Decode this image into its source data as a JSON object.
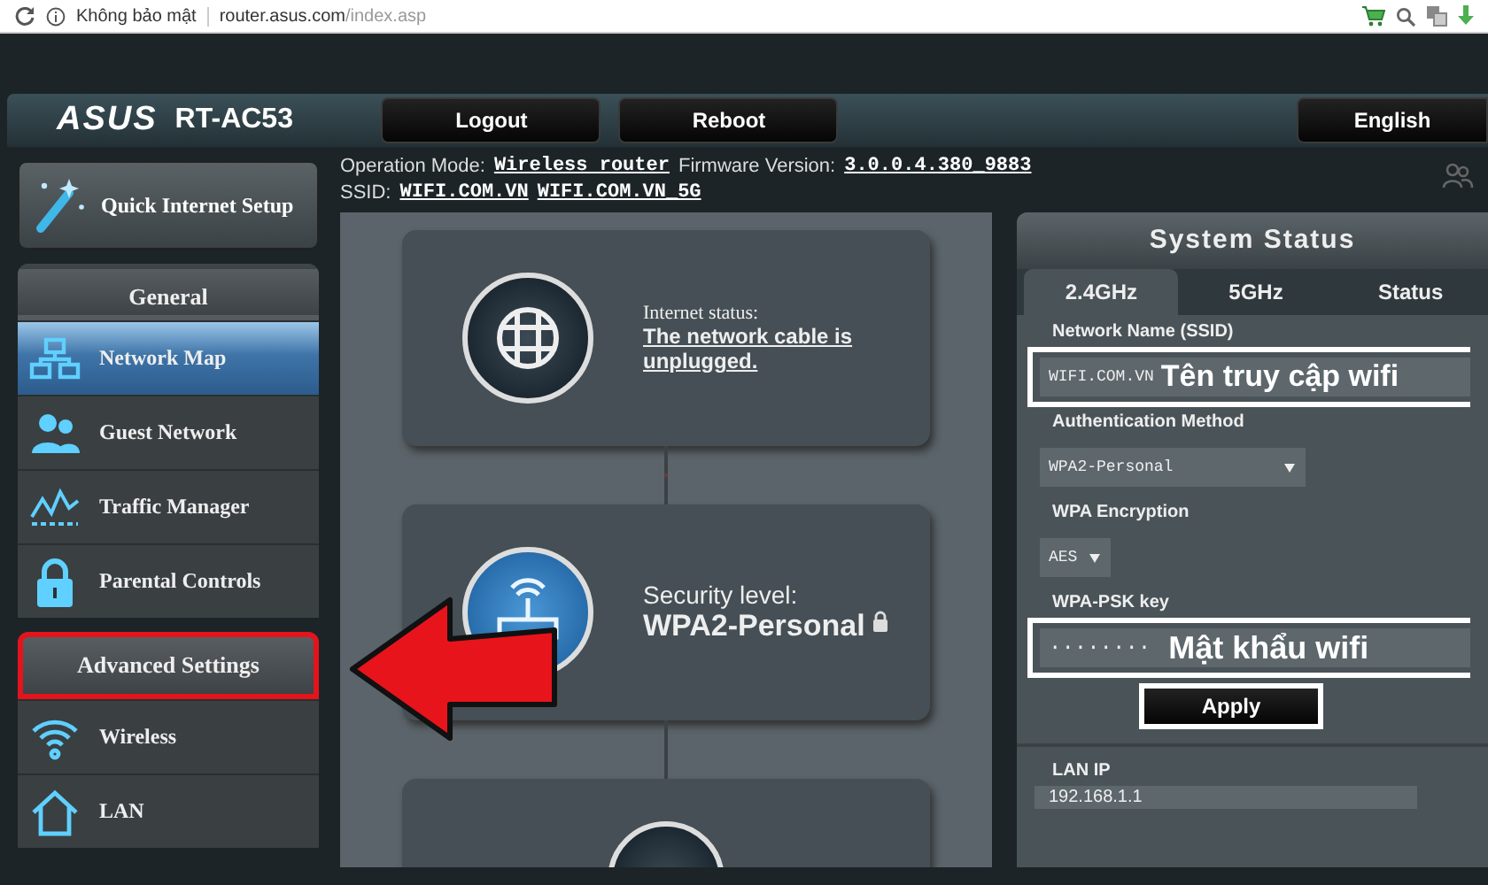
{
  "browser": {
    "security_label": "Không bảo mật",
    "url_host": "router.asus.com",
    "url_path": "/index.asp"
  },
  "header": {
    "logo": "ASUS",
    "model": "RT-AC53",
    "buttons": [
      "Logout",
      "Reboot"
    ],
    "language": "English"
  },
  "info": {
    "operation_mode_label": "Operation Mode:",
    "operation_mode": "Wireless router",
    "firmware_label": "Firmware Version:",
    "firmware": "3.0.0.4.380_9883",
    "ssid_label": "SSID:",
    "ssids": [
      "WIFI.COM.VN",
      "WIFI.COM.VN_5G"
    ]
  },
  "sidebar": {
    "quick_setup": "Quick Internet Setup",
    "sections": [
      {
        "title": "General",
        "highlighted": false,
        "items": [
          {
            "label": "Network Map",
            "kind": "network",
            "selected": true
          },
          {
            "label": "Guest Network",
            "kind": "users",
            "selected": false
          },
          {
            "label": "Traffic Manager",
            "kind": "traffic",
            "selected": false
          },
          {
            "label": "Parental Controls",
            "kind": "lock",
            "selected": false
          }
        ]
      },
      {
        "title": "Advanced Settings",
        "highlighted": true,
        "items": [
          {
            "label": "Wireless",
            "kind": "wifi",
            "selected": false
          },
          {
            "label": "LAN",
            "kind": "home",
            "selected": false
          }
        ]
      }
    ]
  },
  "map": {
    "nodes": [
      {
        "kind": "internet",
        "label": "Internet status:",
        "value": "The network cable is unplugged.",
        "link_broken": true
      },
      {
        "kind": "router",
        "label": "Security level:",
        "value": "WPA2-Personal",
        "locked": true,
        "link_broken": false
      },
      {
        "kind": "device"
      }
    ]
  },
  "status": {
    "title": "System Status",
    "tabs": [
      {
        "label": "2.4GHz",
        "selected": true
      },
      {
        "label": "5GHz",
        "selected": false
      },
      {
        "label": "Status",
        "selected": false
      }
    ],
    "fields": [
      {
        "kind": "text",
        "label": "Network Name (SSID)",
        "value": "WIFI.COM.VN",
        "note": "Tên truy cập wifi",
        "highlighted": true
      },
      {
        "kind": "select",
        "label": "Authentication Method",
        "value": "WPA2-Personal",
        "highlighted": false
      },
      {
        "kind": "select_small",
        "label": "WPA Encryption",
        "value": "AES",
        "highlighted": false
      },
      {
        "kind": "password",
        "label": "WPA-PSK key",
        "value": "········",
        "note": "Mật khẩu wifi",
        "highlighted": true
      }
    ],
    "apply": {
      "label": "Apply",
      "highlighted": true
    },
    "lan_ip_label": "LAN IP",
    "lan_ip": "192.168.1.1"
  }
}
